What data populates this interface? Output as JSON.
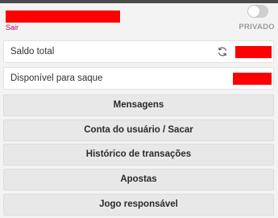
{
  "header": {
    "logout_label": "Sair",
    "private_label": "PRIVADO",
    "private_toggle_on": false
  },
  "balances": [
    {
      "label": "Saldo total",
      "has_refresh": true
    },
    {
      "label": "Disponível para saque",
      "has_refresh": false
    }
  ],
  "menu": [
    {
      "label": "Mensagens"
    },
    {
      "label": "Conta do usuário / Sacar"
    },
    {
      "label": "Histórico de transações"
    },
    {
      "label": "Apostas"
    },
    {
      "label": "Jogo responsável"
    }
  ],
  "colors": {
    "redaction": "#ff0000",
    "logout_link": "#c0006a",
    "toggle_off": "#cfcfcf"
  },
  "icons": {
    "refresh": "refresh-icon"
  }
}
